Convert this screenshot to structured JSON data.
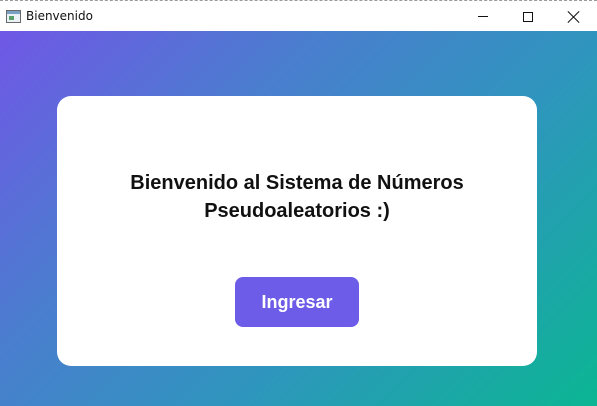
{
  "window": {
    "title": "Bienvenido",
    "controls": [
      "minimize",
      "maximize",
      "close"
    ]
  },
  "card": {
    "heading_line1": "Bienvenido al Sistema de Números",
    "heading_line2": "Pseudoaleatorios :)",
    "button_label": "Ingresar"
  },
  "colors": {
    "gradient_start": "#7057e6",
    "gradient_end": "#0bb693",
    "button": "#6c5ce7",
    "card": "#ffffff"
  }
}
